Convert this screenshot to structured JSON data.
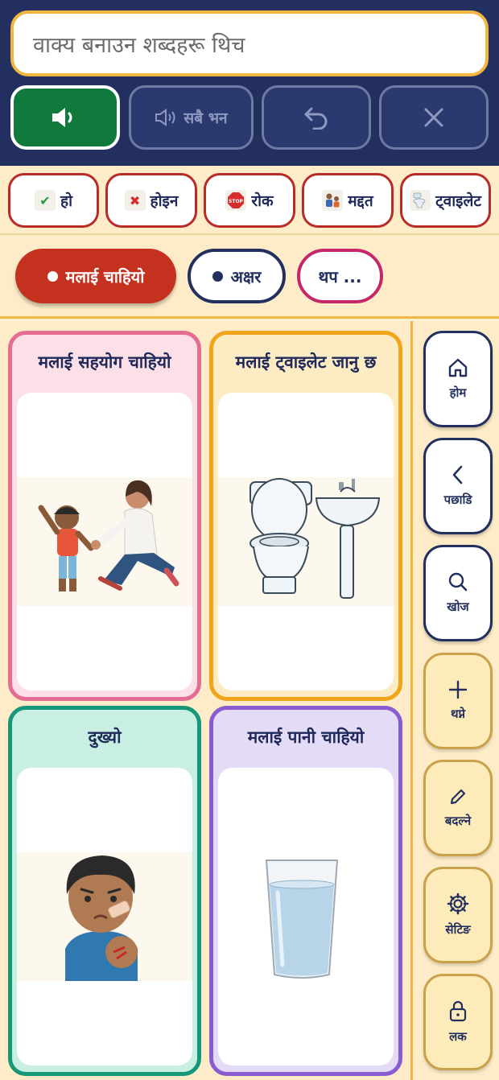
{
  "sentence_bar": {
    "placeholder": "वाक्य बनाउन शब्दहरू थिच"
  },
  "controls": {
    "speak_all_label": "सबै भन"
  },
  "quick_words": [
    {
      "label": "हो",
      "icon": "check-mark-icon"
    },
    {
      "label": "होइन",
      "icon": "cross-mark-icon"
    },
    {
      "label": "रोक",
      "icon": "stop-sign-icon"
    },
    {
      "label": "मद्दत",
      "icon": "helping-people-icon"
    },
    {
      "label": "ट्वाइलेट",
      "icon": "toilet-icon"
    }
  ],
  "categories": [
    {
      "label": "मलाई चाहियो",
      "active": true
    },
    {
      "label": "अक्षर",
      "active": false
    },
    {
      "label": "थप ...",
      "active": false
    }
  ],
  "cards": [
    {
      "title": "मलाई सहयोग चाहियो",
      "image": "adult-helping-child",
      "bg": "#fde0e7",
      "border": "#e56d93"
    },
    {
      "title": "मलाई ट्वाइलेट जानु छ",
      "image": "toilet-and-sink",
      "bg": "#fdebc4",
      "border": "#f0a51a"
    },
    {
      "title": "दुख्यो",
      "image": "hurt-child",
      "bg": "#c9efe2",
      "border": "#16977a"
    },
    {
      "title": "मलाई पानी चाहियो",
      "image": "glass-of-water",
      "bg": "#e4dcf6",
      "border": "#8a5cd0"
    }
  ],
  "side_nav": {
    "home": "होम",
    "back": "पछाडि",
    "search": "खोज",
    "add": "थप्ने",
    "edit": "बदल्ने",
    "settings": "सेटिङ",
    "lock": "लक"
  },
  "colors": {
    "header_bg": "#23305f",
    "speak_green": "#0f7a3c",
    "accent_yellow": "#f2b640",
    "active_red": "#c4321f"
  }
}
